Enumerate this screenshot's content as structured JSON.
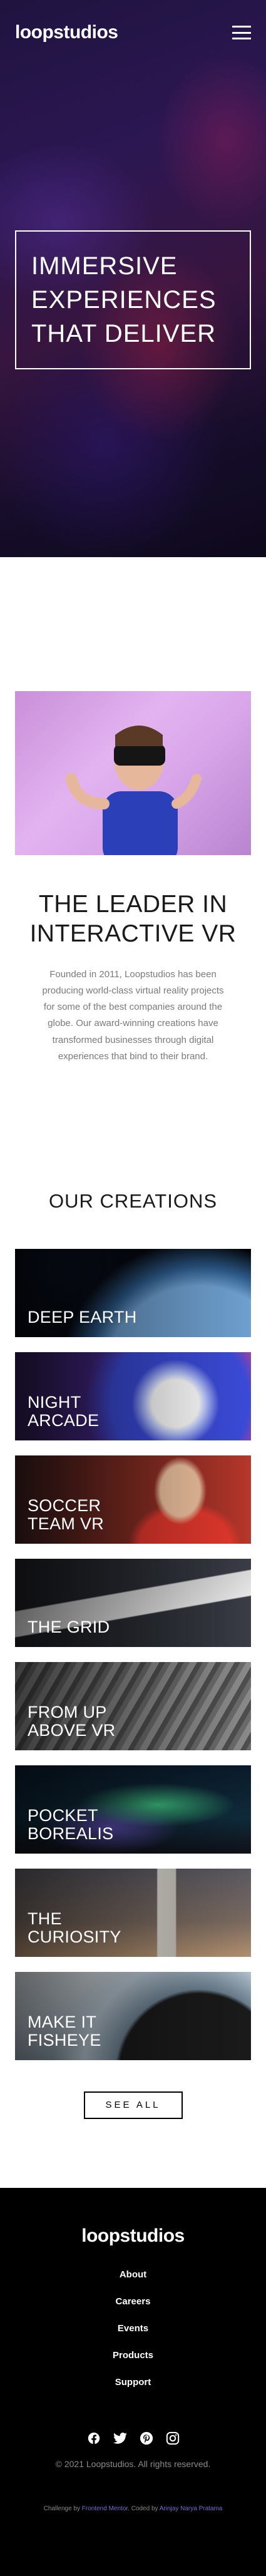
{
  "header": {
    "logo": "loopstudios",
    "menu_icon": "hamburger-menu-icon"
  },
  "hero": {
    "title": "IMMERSIVE EXPERIENCES THAT DELIVER"
  },
  "interactive": {
    "title": "THE LEADER IN INTERACTIVE VR",
    "text": "Founded in 2011, Loopstudios has been producing world-class virtual reality projects for some of the best companies around the globe. Our award-winning creations have transformed businesses through digital experiences that bind to their brand."
  },
  "creations": {
    "title": "OUR CREATIONS",
    "items": [
      {
        "label": "DEEP EARTH"
      },
      {
        "label": "NIGHT ARCADE"
      },
      {
        "label": "SOCCER TEAM VR"
      },
      {
        "label": "THE GRID"
      },
      {
        "label": "FROM UP ABOVE VR"
      },
      {
        "label": "POCKET BOREALIS"
      },
      {
        "label": "THE CURIOSITY"
      },
      {
        "label": "MAKE IT FISHEYE"
      }
    ],
    "see_all": "SEE ALL"
  },
  "footer": {
    "logo": "loopstudios",
    "nav": [
      "About",
      "Careers",
      "Events",
      "Products",
      "Support"
    ],
    "socials": [
      "facebook-icon",
      "twitter-icon",
      "pinterest-icon",
      "instagram-icon"
    ],
    "copyright": "© 2021 Loopstudios. All rights reserved.",
    "attribution": {
      "prefix": "Challenge by",
      "challenge_link": "Frontend Mentor",
      "middle": ". Coded by",
      "author_link": "Arinjay Narya Pratama"
    }
  }
}
